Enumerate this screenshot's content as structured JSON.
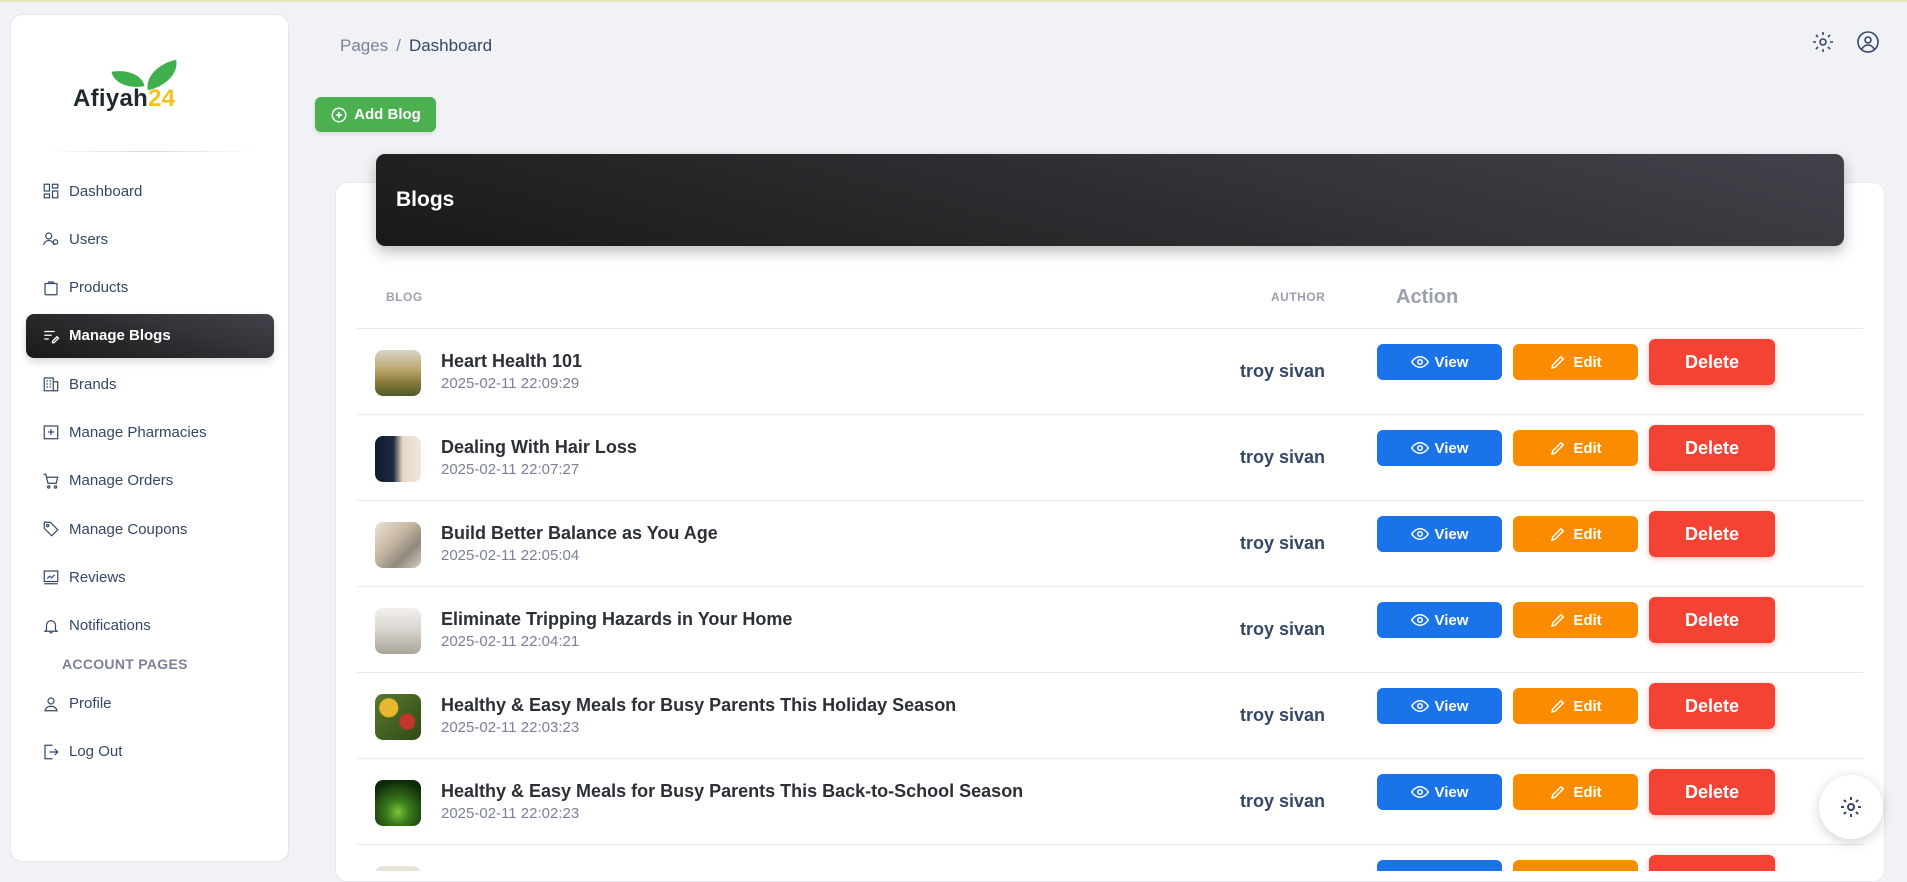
{
  "brand": {
    "name": "Afiyah",
    "number": "24"
  },
  "sidebar": {
    "items": [
      {
        "label": "Dashboard",
        "icon": "dashboard-icon"
      },
      {
        "label": "Users",
        "icon": "users-icon"
      },
      {
        "label": "Products",
        "icon": "products-icon"
      },
      {
        "label": "Manage Blogs",
        "icon": "blog-icon"
      },
      {
        "label": "Brands",
        "icon": "brands-icon"
      },
      {
        "label": "Manage Pharmacies",
        "icon": "pharmacy-icon"
      },
      {
        "label": "Manage Orders",
        "icon": "cart-icon"
      },
      {
        "label": "Manage Coupons",
        "icon": "tag-icon"
      },
      {
        "label": "Reviews",
        "icon": "reviews-icon"
      },
      {
        "label": "Notifications",
        "icon": "bell-icon"
      }
    ],
    "active": "Manage Blogs",
    "account_label": "ACCOUNT PAGES",
    "account_items": [
      {
        "label": "Profile",
        "icon": "profile-icon"
      },
      {
        "label": "Log Out",
        "icon": "logout-icon"
      }
    ]
  },
  "breadcrumb": {
    "parent": "Pages",
    "separator": "/",
    "current": "Dashboard"
  },
  "add_button": "Add Blog",
  "card": {
    "title": "Blogs"
  },
  "table": {
    "headers": {
      "blog": "BLOG",
      "author": "AUTHOR",
      "action": "Action"
    },
    "rows": [
      {
        "title": "Heart Health 101",
        "date": "2025-02-11 22:09:29",
        "author": "troy sivan"
      },
      {
        "title": "Dealing With Hair Loss",
        "date": "2025-02-11 22:07:27",
        "author": "troy sivan"
      },
      {
        "title": "Build Better Balance as You Age",
        "date": "2025-02-11 22:05:04",
        "author": "troy sivan"
      },
      {
        "title": "Eliminate Tripping Hazards in Your Home",
        "date": "2025-02-11 22:04:21",
        "author": "troy sivan"
      },
      {
        "title": "Healthy & Easy Meals for Busy Parents This Holiday Season",
        "date": "2025-02-11 22:03:23",
        "author": "troy sivan"
      },
      {
        "title": "Healthy & Easy Meals for Busy Parents This Back-to-School Season",
        "date": "2025-02-11 22:02:23",
        "author": "troy sivan"
      }
    ],
    "buttons": {
      "view": "View",
      "edit": "Edit",
      "delete": "Delete"
    }
  },
  "colors": {
    "view": "#1a73e8",
    "edit": "#fb8c00",
    "delete": "#f44335",
    "add": "#4caf50",
    "dark": "#191919"
  }
}
